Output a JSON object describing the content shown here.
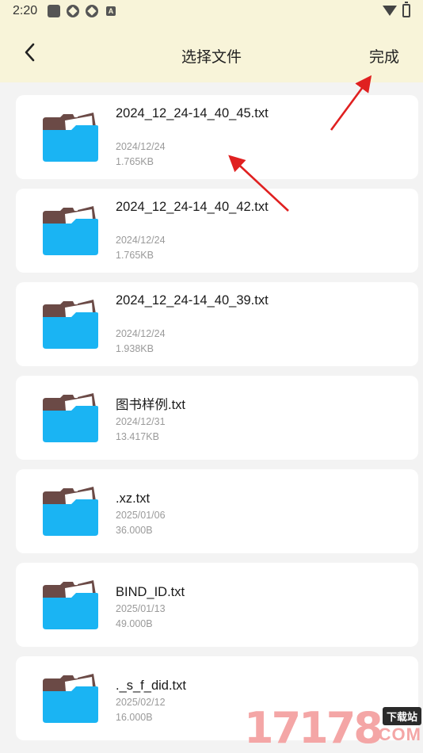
{
  "status_bar": {
    "time": "2:20",
    "notification_letter": "A",
    "icons": [
      "gallery-icon",
      "sync-icon",
      "sync-icon",
      "a-badge-icon",
      "wifi-icon",
      "battery-icon"
    ]
  },
  "header": {
    "title": "选择文件",
    "done_label": "完成",
    "back_icon": "chevron-left-icon",
    "background": "#f8f4d9"
  },
  "files": [
    {
      "name": "2024_12_24-14_40_45.txt",
      "date": "2024/12/24",
      "size": "1.765KB"
    },
    {
      "name": "2024_12_24-14_40_42.txt",
      "date": "2024/12/24",
      "size": "1.765KB"
    },
    {
      "name": "2024_12_24-14_40_39.txt",
      "date": "2024/12/24",
      "size": "1.938KB"
    },
    {
      "name": "图书样例.txt",
      "date": "2024/12/31",
      "size": "13.417KB"
    },
    {
      "name": ".xz.txt",
      "date": "2025/01/06",
      "size": "36.000B"
    },
    {
      "name": "BIND_ID.txt",
      "date": "2025/01/13",
      "size": "49.000B"
    },
    {
      "name": "._s_f_did.txt",
      "date": "2025/02/12",
      "size": "16.000B"
    }
  ],
  "colors": {
    "folder_front": "#1ab4f3",
    "folder_back": "#6b4a46",
    "folder_paper": "#ffffff",
    "annotation_arrow": "#e02020",
    "card_bg": "#ffffff",
    "list_bg": "#f3f3f3"
  },
  "watermark": {
    "digits": "17178",
    "badge": "下载站",
    "suffix": ".COM"
  }
}
